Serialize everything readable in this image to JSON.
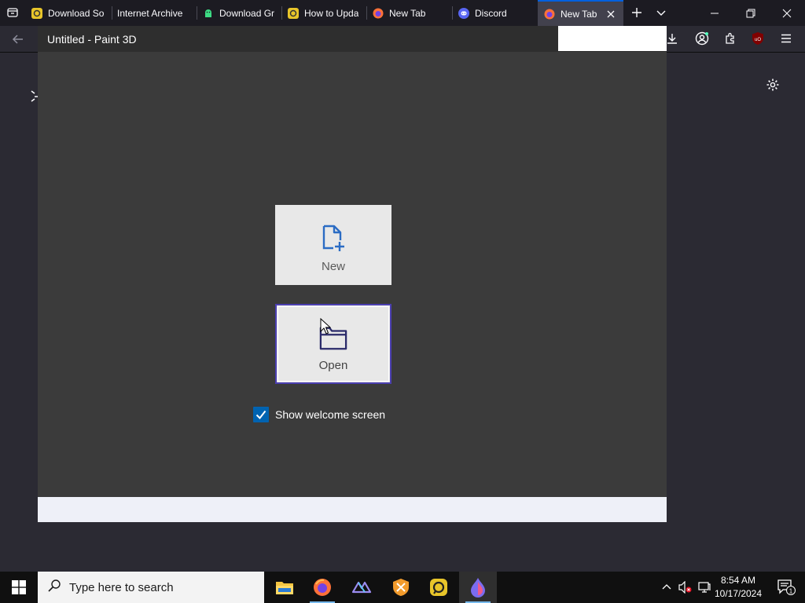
{
  "browser": {
    "tabs": [
      {
        "label": "Download So",
        "favicon": "scribd-icon"
      },
      {
        "label": "Internet Archive",
        "favicon": "none"
      },
      {
        "label": "Download Gr",
        "favicon": "android-icon"
      },
      {
        "label": "How to Upda",
        "favicon": "scribd-icon"
      },
      {
        "label": "New Tab",
        "favicon": "firefox-icon"
      },
      {
        "label": "Discord",
        "favicon": "discord-icon"
      },
      {
        "label": "New Tab",
        "favicon": "firefox-icon",
        "active": true
      }
    ]
  },
  "paint": {
    "title": "Untitled - Paint 3D",
    "new_label": "New",
    "open_label": "Open",
    "show_welcome_label": "Show welcome screen",
    "show_welcome_checked": true
  },
  "taskbar": {
    "search_placeholder": "Type here to search",
    "time": "8:54 AM",
    "date": "10/17/2024",
    "notification_count": "1",
    "apps": [
      "file-explorer-icon",
      "firefox-icon",
      "affinity-icon",
      "vpn-shield-icon",
      "scribd-icon",
      "paint-3d-icon"
    ]
  },
  "colors": {
    "accent": "#0063b1",
    "open_border": "#4b3fb0",
    "tab_active_bar": "#0060df"
  }
}
